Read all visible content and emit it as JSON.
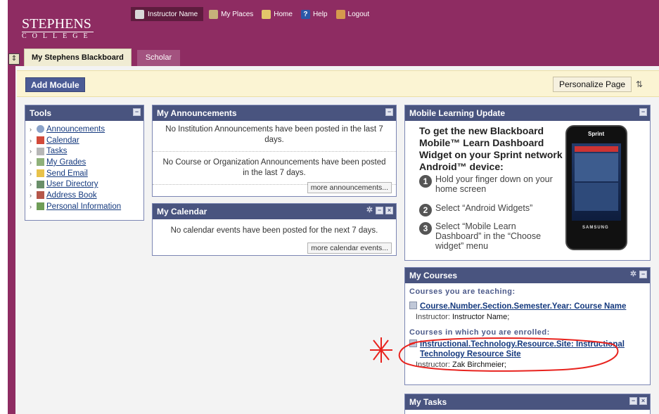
{
  "header": {
    "logo_line1": "STEPHENS",
    "logo_line2": "COLLEGE"
  },
  "topnav": {
    "instructor": "Instructor Name",
    "my_places": "My Places",
    "home": "Home",
    "help": "Help",
    "logout": "Logout"
  },
  "tabs": [
    {
      "label": "My Stephens Blackboard"
    },
    {
      "label": "Scholar"
    }
  ],
  "toolbar": {
    "add_module": "Add Module",
    "personalize": "Personalize Page",
    "reorder_glyph": "⇅"
  },
  "tools": {
    "title": "Tools",
    "items": [
      {
        "label": "Announcements"
      },
      {
        "label": "Calendar"
      },
      {
        "label": "Tasks"
      },
      {
        "label": "My Grades"
      },
      {
        "label": "Send Email"
      },
      {
        "label": "User Directory"
      },
      {
        "label": "Address Book"
      },
      {
        "label": "Personal Information"
      }
    ]
  },
  "announcements": {
    "title": "My Announcements",
    "msg1": "No Institution Announcements have been posted in the last 7 days.",
    "msg2": "No Course or Organization Announcements have been posted in the last 7 days.",
    "more": "more announcements..."
  },
  "calendar": {
    "title": "My Calendar",
    "msg": "No calendar events have been posted for the next 7 days.",
    "more": "more calendar events..."
  },
  "mobile": {
    "title": "Mobile Learning Update",
    "heading": "To get the new Blackboard Mobile™ Learn Dashboard Widget on your Sprint network Android™ device:",
    "steps": [
      {
        "n": "1",
        "text": "Hold your finger down on your home screen"
      },
      {
        "n": "2",
        "text": "Select “Android Widgets”"
      },
      {
        "n": "3",
        "text": "Select “Mobile Learn Dashboard” in the “Choose widget” menu"
      }
    ],
    "phone_brand": "Sprint",
    "phone_maker": "SAMSUNG"
  },
  "courses": {
    "title": "My Courses",
    "teaching_label": "Courses you are teaching:",
    "teaching": {
      "name": "Course.Number.Section.Semester.Year: Course Name",
      "instructor_label": "Instructor:",
      "instructor": "Instructor Name;"
    },
    "enrolled_label": "Courses in which you are enrolled:",
    "enrolled": {
      "name": "Instructional.Technology.Resource.Site: Instructional Technology Resource Site",
      "instructor_label": "Instructor:",
      "instructor": "Zak Birchmeier;"
    }
  },
  "tasks": {
    "title": "My Tasks"
  },
  "colors": {
    "brand": "#8e2c62",
    "module_header": "#49547f",
    "annotation": "#e8231e"
  }
}
